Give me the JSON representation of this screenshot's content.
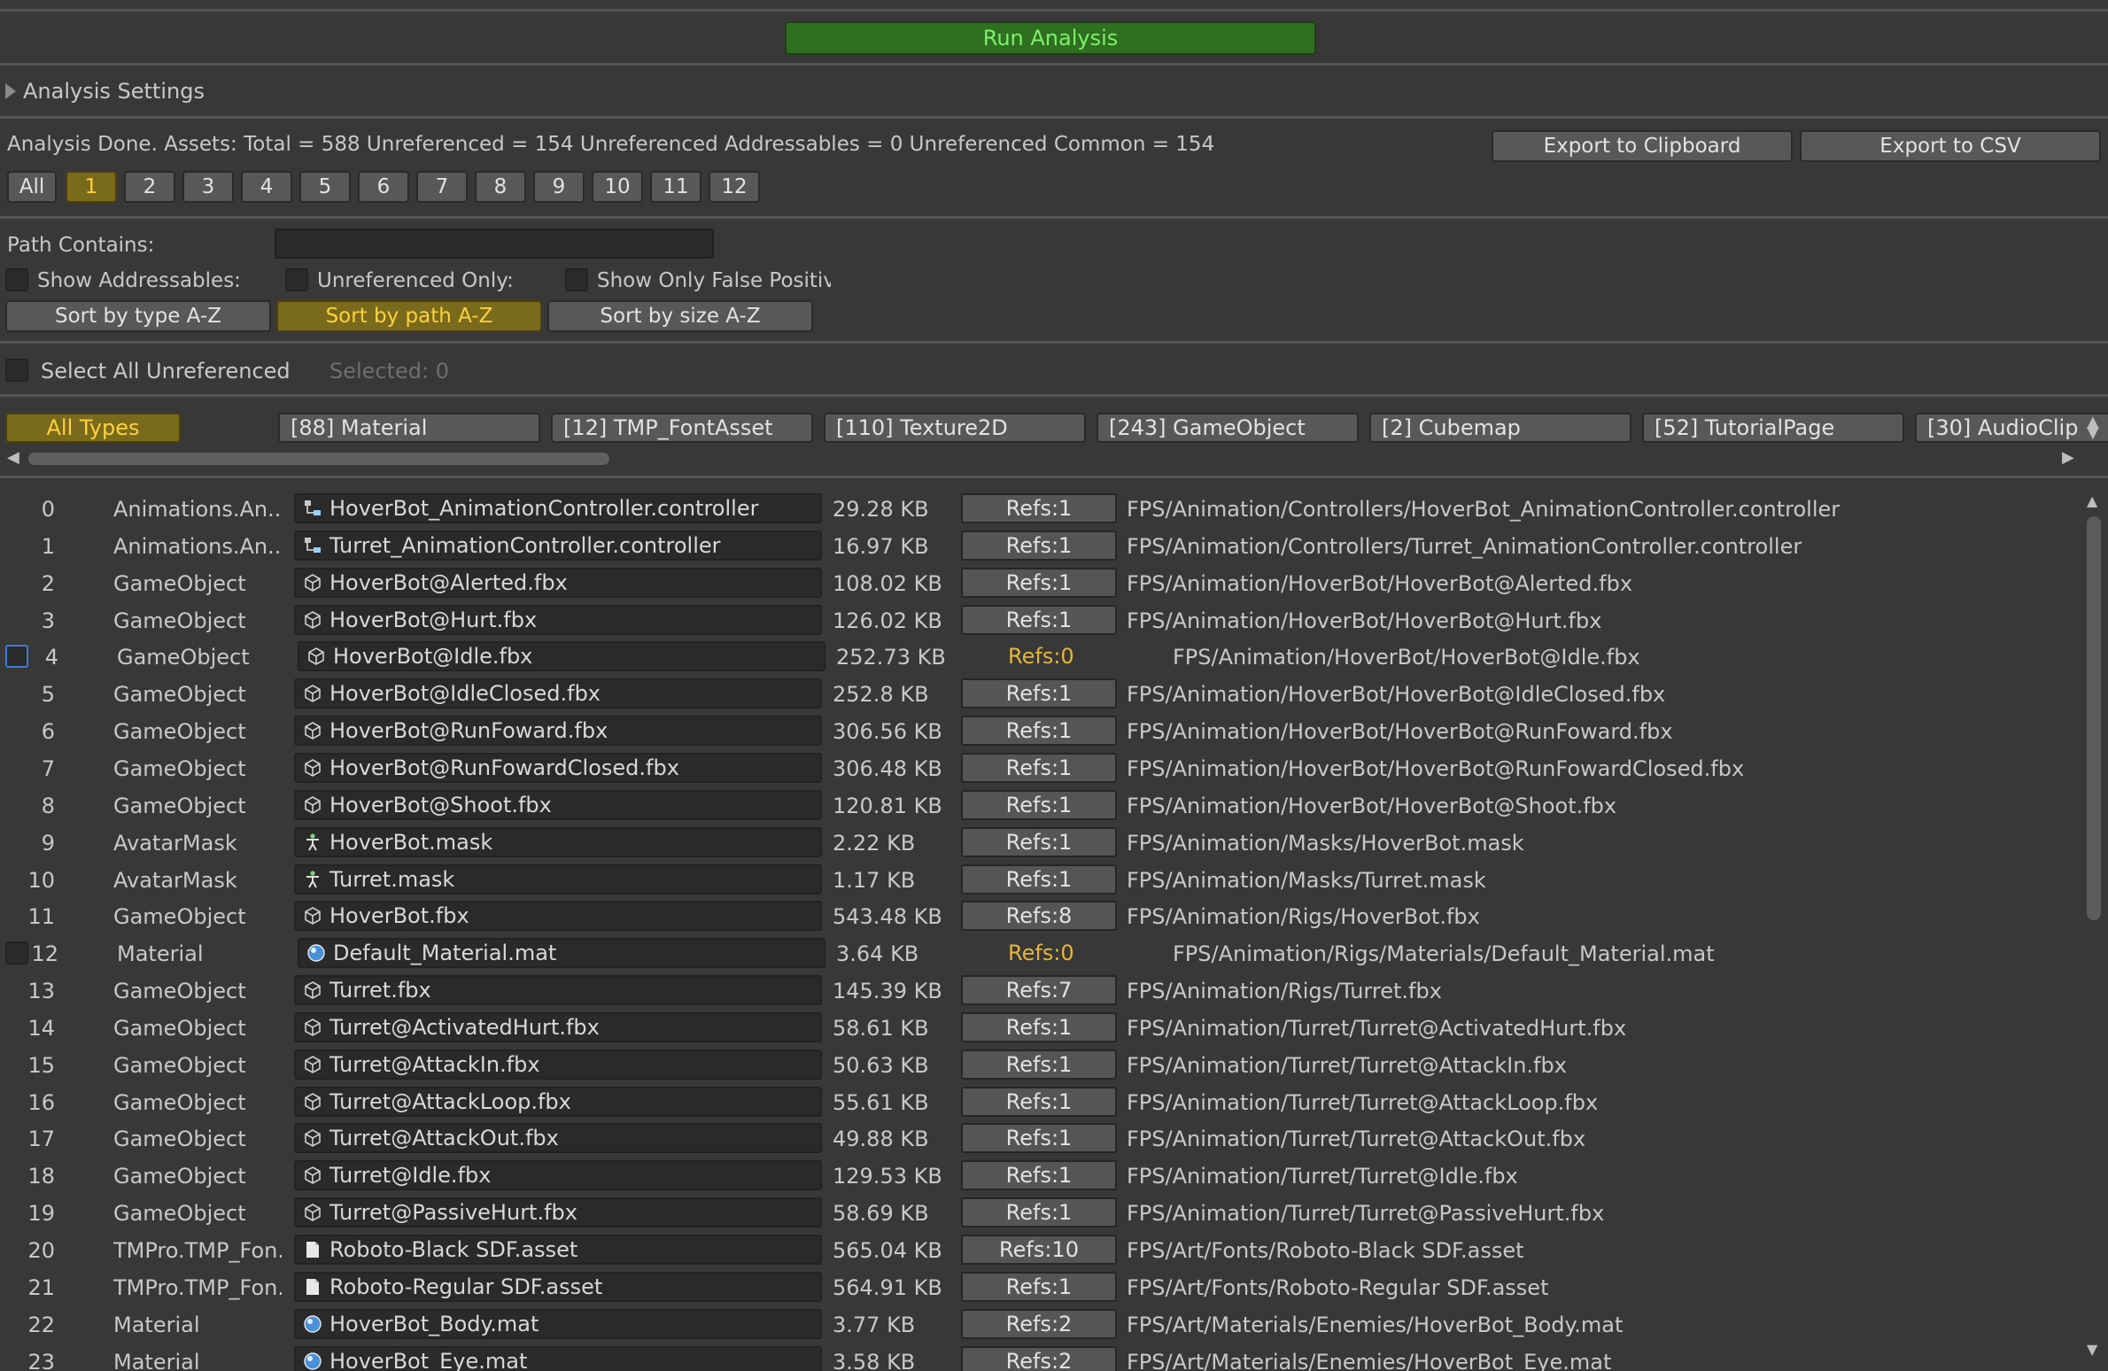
{
  "toolbar": {
    "run_label": "Run Analysis"
  },
  "settings": {
    "label": "Analysis Settings"
  },
  "status": {
    "text": "Analysis Done. Assets: Total = 588 Unreferenced = 154 Unreferenced Addressables = 0 Unreferenced Common = 154",
    "export_clipboard": "Export to Clipboard",
    "export_csv": "Export to CSV"
  },
  "pages": {
    "items": [
      "All",
      "1",
      "2",
      "3",
      "4",
      "5",
      "6",
      "7",
      "8",
      "9",
      "10",
      "11",
      "12"
    ],
    "selected": "1"
  },
  "filters": {
    "path_label": "Path Contains:",
    "path_value": "",
    "show_addressables": "Show Addressables:",
    "unreferenced_only": "Unreferenced Only:",
    "show_false_positives": "Show Only False Positiv",
    "sort_type": "Sort by type A-Z",
    "sort_path": "Sort by path A-Z",
    "sort_size": "Sort by size A-Z",
    "active_sort": "path"
  },
  "selection": {
    "select_all": "Select All Unreferenced",
    "selected": "Selected: 0"
  },
  "type_tabs": [
    "All Types",
    "[88] Material",
    "[12] TMP_FontAsset",
    "[110] Texture2D",
    "[243] GameObject",
    "[2] Cubemap",
    "[52] TutorialPage",
    "[30] AudioClip"
  ],
  "colors": {
    "accent_active": "#7a6a1c",
    "run_button": "#2f6f22",
    "refs_zero": "#e6b63a",
    "checkbox_focus": "#3d7bd6"
  },
  "rows": [
    {
      "idx": "0",
      "type": "Animations.An..",
      "icon": "animator-icon",
      "name": "HoverBot_AnimationController.controller",
      "size": "29.28 KB",
      "refs": "Refs:1",
      "path": "FPS/Animation/Controllers/HoverBot_AnimationController.controller"
    },
    {
      "idx": "1",
      "type": "Animations.An..",
      "icon": "animator-icon",
      "name": "Turret_AnimationController.controller",
      "size": "16.97 KB",
      "refs": "Refs:1",
      "path": "FPS/Animation/Controllers/Turret_AnimationController.controller"
    },
    {
      "idx": "2",
      "type": "GameObject",
      "icon": "cube-icon",
      "name": "HoverBot@Alerted.fbx",
      "size": "108.02 KB",
      "refs": "Refs:1",
      "path": "FPS/Animation/HoverBot/HoverBot@Alerted.fbx"
    },
    {
      "idx": "3",
      "type": "GameObject",
      "icon": "cube-icon",
      "name": "HoverBot@Hurt.fbx",
      "size": "126.02 KB",
      "refs": "Refs:1",
      "path": "FPS/Animation/HoverBot/HoverBot@Hurt.fbx"
    },
    {
      "idx": "4",
      "type": "GameObject",
      "icon": "cube-icon",
      "name": "HoverBot@Idle.fbx",
      "size": "252.73 KB",
      "refs": "Refs:0",
      "path": "FPS/Animation/HoverBot/HoverBot@Idle.fbx",
      "unref": true,
      "focus": true
    },
    {
      "idx": "5",
      "type": "GameObject",
      "icon": "cube-icon",
      "name": "HoverBot@IdleClosed.fbx",
      "size": "252.8 KB",
      "refs": "Refs:1",
      "path": "FPS/Animation/HoverBot/HoverBot@IdleClosed.fbx"
    },
    {
      "idx": "6",
      "type": "GameObject",
      "icon": "cube-icon",
      "name": "HoverBot@RunFoward.fbx",
      "size": "306.56 KB",
      "refs": "Refs:1",
      "path": "FPS/Animation/HoverBot/HoverBot@RunFoward.fbx"
    },
    {
      "idx": "7",
      "type": "GameObject",
      "icon": "cube-icon",
      "name": "HoverBot@RunFowardClosed.fbx",
      "size": "306.48 KB",
      "refs": "Refs:1",
      "path": "FPS/Animation/HoverBot/HoverBot@RunFowardClosed.fbx"
    },
    {
      "idx": "8",
      "type": "GameObject",
      "icon": "cube-icon",
      "name": "HoverBot@Shoot.fbx",
      "size": "120.81 KB",
      "refs": "Refs:1",
      "path": "FPS/Animation/HoverBot/HoverBot@Shoot.fbx"
    },
    {
      "idx": "9",
      "type": "AvatarMask",
      "icon": "avatar-mask-icon",
      "name": "HoverBot.mask",
      "size": "2.22 KB",
      "refs": "Refs:1",
      "path": "FPS/Animation/Masks/HoverBot.mask"
    },
    {
      "idx": "10",
      "type": "AvatarMask",
      "icon": "avatar-mask-icon",
      "name": "Turret.mask",
      "size": "1.17 KB",
      "refs": "Refs:1",
      "path": "FPS/Animation/Masks/Turret.mask"
    },
    {
      "idx": "11",
      "type": "GameObject",
      "icon": "cube-icon",
      "name": "HoverBot.fbx",
      "size": "543.48 KB",
      "refs": "Refs:8",
      "path": "FPS/Animation/Rigs/HoverBot.fbx"
    },
    {
      "idx": "12",
      "type": "Material",
      "icon": "material-sphere-icon",
      "name": "Default_Material.mat",
      "size": "3.64 KB",
      "refs": "Refs:0",
      "path": "FPS/Animation/Rigs/Materials/Default_Material.mat",
      "unref": true
    },
    {
      "idx": "13",
      "type": "GameObject",
      "icon": "cube-icon",
      "name": "Turret.fbx",
      "size": "145.39 KB",
      "refs": "Refs:7",
      "path": "FPS/Animation/Rigs/Turret.fbx"
    },
    {
      "idx": "14",
      "type": "GameObject",
      "icon": "cube-icon",
      "name": "Turret@ActivatedHurt.fbx",
      "size": "58.61 KB",
      "refs": "Refs:1",
      "path": "FPS/Animation/Turret/Turret@ActivatedHurt.fbx"
    },
    {
      "idx": "15",
      "type": "GameObject",
      "icon": "cube-icon",
      "name": "Turret@AttackIn.fbx",
      "size": "50.63 KB",
      "refs": "Refs:1",
      "path": "FPS/Animation/Turret/Turret@AttackIn.fbx"
    },
    {
      "idx": "16",
      "type": "GameObject",
      "icon": "cube-icon",
      "name": "Turret@AttackLoop.fbx",
      "size": "55.61 KB",
      "refs": "Refs:1",
      "path": "FPS/Animation/Turret/Turret@AttackLoop.fbx"
    },
    {
      "idx": "17",
      "type": "GameObject",
      "icon": "cube-icon",
      "name": "Turret@AttackOut.fbx",
      "size": "49.88 KB",
      "refs": "Refs:1",
      "path": "FPS/Animation/Turret/Turret@AttackOut.fbx"
    },
    {
      "idx": "18",
      "type": "GameObject",
      "icon": "cube-icon",
      "name": "Turret@Idle.fbx",
      "size": "129.53 KB",
      "refs": "Refs:1",
      "path": "FPS/Animation/Turret/Turret@Idle.fbx"
    },
    {
      "idx": "19",
      "type": "GameObject",
      "icon": "cube-icon",
      "name": "Turret@PassiveHurt.fbx",
      "size": "58.69 KB",
      "refs": "Refs:1",
      "path": "FPS/Animation/Turret/Turret@PassiveHurt.fbx"
    },
    {
      "idx": "20",
      "type": "TMPro.TMP_Fon..",
      "icon": "document-icon",
      "name": "Roboto-Black SDF.asset",
      "size": "565.04 KB",
      "refs": "Refs:10",
      "path": "FPS/Art/Fonts/Roboto-Black SDF.asset"
    },
    {
      "idx": "21",
      "type": "TMPro.TMP_Fon..",
      "icon": "document-icon",
      "name": "Roboto-Regular SDF.asset",
      "size": "564.91 KB",
      "refs": "Refs:1",
      "path": "FPS/Art/Fonts/Roboto-Regular SDF.asset"
    },
    {
      "idx": "22",
      "type": "Material",
      "icon": "material-sphere-icon",
      "name": "HoverBot_Body.mat",
      "size": "3.77 KB",
      "refs": "Refs:2",
      "path": "FPS/Art/Materials/Enemies/HoverBot_Body.mat"
    },
    {
      "idx": "23",
      "type": "Material",
      "icon": "material-sphere-icon",
      "name": "HoverBot_Eye.mat",
      "size": "3.58 KB",
      "refs": "Refs:2",
      "path": "FPS/Art/Materials/Enemies/HoverBot_Eye.mat"
    }
  ]
}
